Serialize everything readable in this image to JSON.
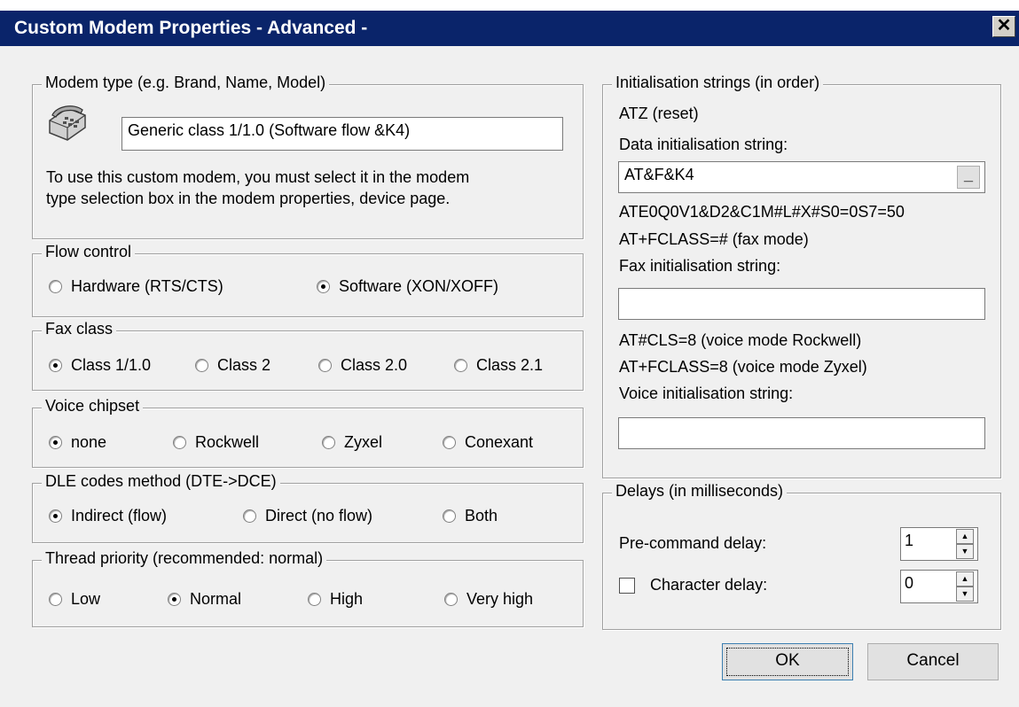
{
  "window": {
    "title": "Custom Modem Properties - Advanced -",
    "close_label": "✕"
  },
  "modem_type": {
    "legend": "Modem type (e.g. Brand, Name, Model)",
    "icon": "telephone-icon",
    "value": "Generic class 1/1.0 (Software flow &K4)",
    "info_line1": "To use this custom modem, you must select it in the modem",
    "info_line2": "type selection box in the modem properties, device page."
  },
  "flow_control": {
    "legend": "Flow control",
    "options": [
      {
        "label": "Hardware (RTS/CTS)",
        "selected": false
      },
      {
        "label": "Software (XON/XOFF)",
        "selected": true
      }
    ]
  },
  "fax_class": {
    "legend": "Fax class",
    "options": [
      {
        "label": "Class 1/1.0",
        "selected": true
      },
      {
        "label": "Class 2",
        "selected": false
      },
      {
        "label": "Class 2.0",
        "selected": false
      },
      {
        "label": "Class 2.1",
        "selected": false
      }
    ]
  },
  "voice_chipset": {
    "legend": "Voice chipset",
    "options": [
      {
        "label": "none",
        "selected": true
      },
      {
        "label": "Rockwell",
        "selected": false
      },
      {
        "label": "Zyxel",
        "selected": false
      },
      {
        "label": "Conexant",
        "selected": false
      }
    ]
  },
  "dle_codes": {
    "legend": "DLE codes method (DTE->DCE)",
    "options": [
      {
        "label": "Indirect (flow)",
        "selected": true
      },
      {
        "label": "Direct (no flow)",
        "selected": false
      },
      {
        "label": "Both",
        "selected": false
      }
    ]
  },
  "thread_priority": {
    "legend": "Thread priority (recommended: normal)",
    "options": [
      {
        "label": "Low",
        "selected": false
      },
      {
        "label": "Normal",
        "selected": true
      },
      {
        "label": "High",
        "selected": false
      },
      {
        "label": "Very high",
        "selected": false
      }
    ]
  },
  "init_strings": {
    "legend": "Initialisation strings (in order)",
    "reset_text": "ATZ (reset)",
    "data_label": "Data initialisation string:",
    "data_value": "AT&F&K4",
    "data_button": "_",
    "data_fixed": "ATE0Q0V1&D2&C1M#L#X#S0=0S7=50",
    "fax_mode_text": "AT+FCLASS=# (fax mode)",
    "fax_label": "Fax initialisation string:",
    "fax_value": "",
    "voice_rockwell_text": "AT#CLS=8 (voice mode Rockwell)",
    "voice_zyxel_text": "AT+FCLASS=8 (voice mode Zyxel)",
    "voice_label": "Voice initialisation string:",
    "voice_value": ""
  },
  "delays": {
    "legend": "Delays (in milliseconds)",
    "precommand_label": "Pre-command delay:",
    "precommand_value": "1",
    "character_label": "Character delay:",
    "character_checked": false,
    "character_value": "0"
  },
  "buttons": {
    "ok": "OK",
    "cancel": "Cancel"
  }
}
